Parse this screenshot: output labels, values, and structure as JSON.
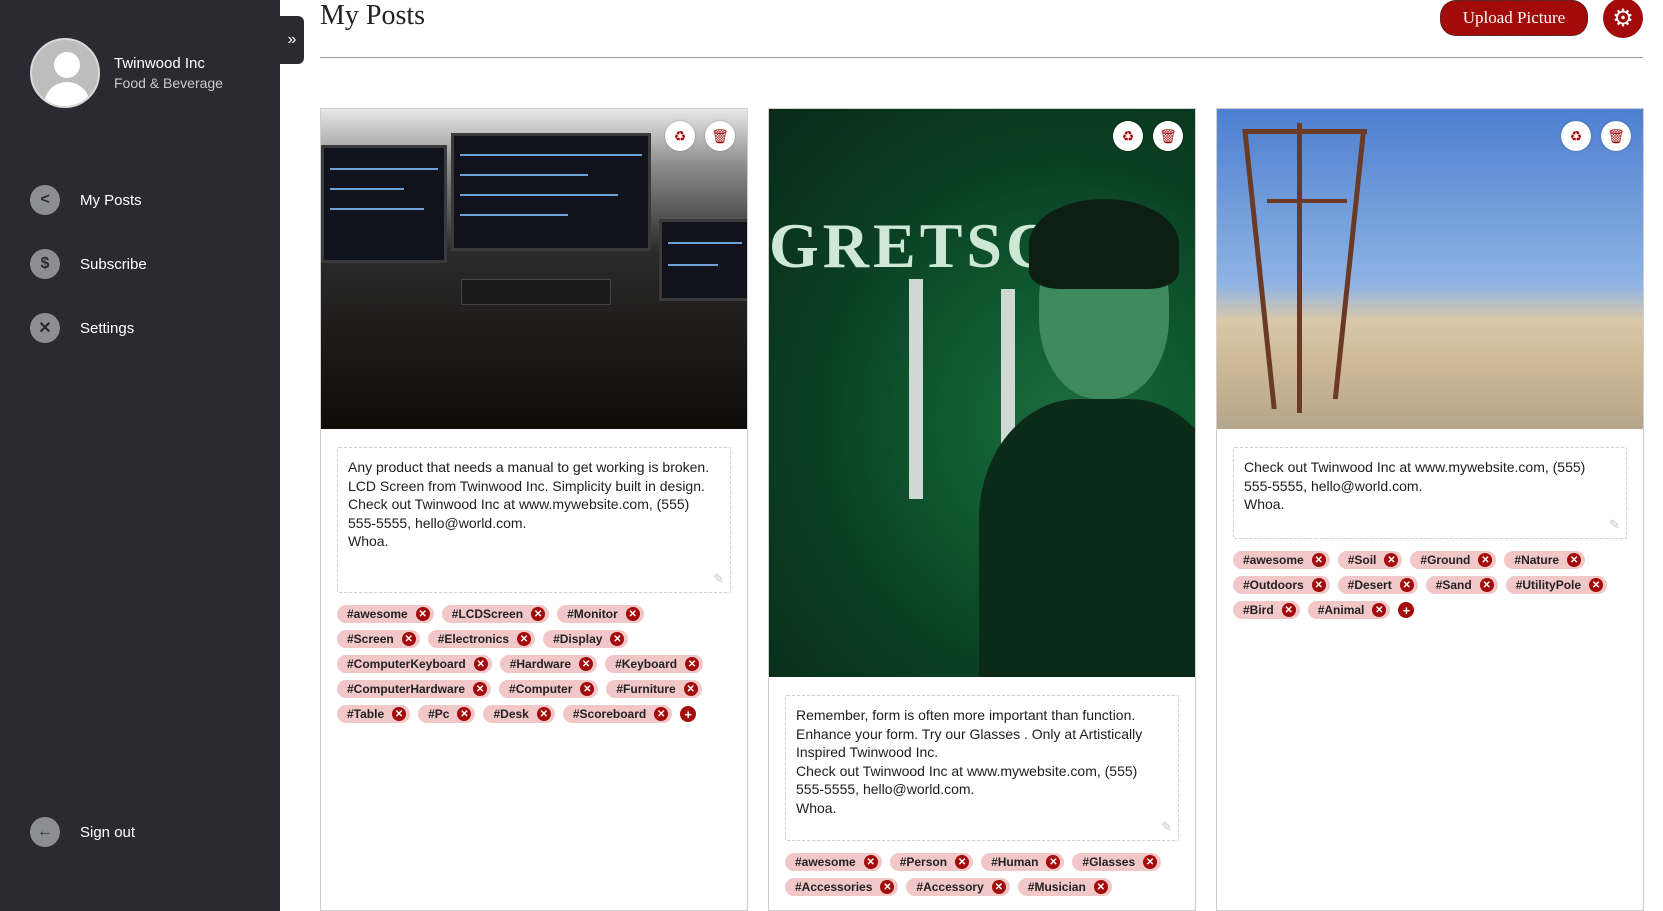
{
  "sidebar": {
    "company": "Twinwood Inc",
    "industry": "Food & Beverage",
    "collapse_icon": "»",
    "items": [
      {
        "label": "My Posts",
        "icon": "share-icon",
        "glyph": "<"
      },
      {
        "label": "Subscribe",
        "icon": "dollar-icon",
        "glyph": "$"
      },
      {
        "label": "Settings",
        "icon": "tools-icon",
        "glyph": "✕"
      }
    ],
    "signout": {
      "label": "Sign out",
      "icon": "arrow-left-icon",
      "glyph": "←"
    }
  },
  "header": {
    "title": "My Posts",
    "upload_label": "Upload Picture",
    "settings_glyph": "⚙"
  },
  "colors": {
    "accent": "#a30a0a",
    "sidebar_bg": "#2b2a33",
    "tag_bg": "#f1c7c7"
  },
  "posts": [
    {
      "caption": "Any product that needs a manual to get working is broken. LCD Screen from Twinwood Inc. Simplicity built in design.\nCheck out Twinwood Inc at www.mywebsite.com, (555) 555-5555, hello@world.com.\nWhoa.",
      "tags": [
        "#awesome",
        "#LCDScreen",
        "#Monitor",
        "#Screen",
        "#Electronics",
        "#Display",
        "#ComputerKeyboard",
        "#Hardware",
        "#Keyboard",
        "#ComputerHardware",
        "#Computer",
        "#Furniture",
        "#Table",
        "#Pc",
        "#Desk",
        "#Scoreboard"
      ]
    },
    {
      "caption_top": "GRETSCH",
      "caption": "Remember, form is often more important than function. Enhance your form. Try our Glasses . Only at Artistically Inspired Twinwood Inc.\nCheck out Twinwood Inc at www.mywebsite.com, (555) 555-5555, hello@world.com.\nWhoa.",
      "tags": [
        "#awesome",
        "#Person",
        "#Human",
        "#Glasses",
        "#Accessories",
        "#Accessory",
        "#Musician"
      ]
    },
    {
      "caption": "Check out Twinwood Inc at www.mywebsite.com, (555) 555-5555, hello@world.com.\nWhoa.",
      "tags": [
        "#awesome",
        "#Soil",
        "#Ground",
        "#Nature",
        "#Outdoors",
        "#Desert",
        "#Sand",
        "#UtilityPole",
        "#Bird",
        "#Animal"
      ]
    }
  ],
  "icons": {
    "recycle": "♻",
    "delete": "🗑",
    "remove": "✕",
    "add": "+",
    "pencil": "✎"
  }
}
